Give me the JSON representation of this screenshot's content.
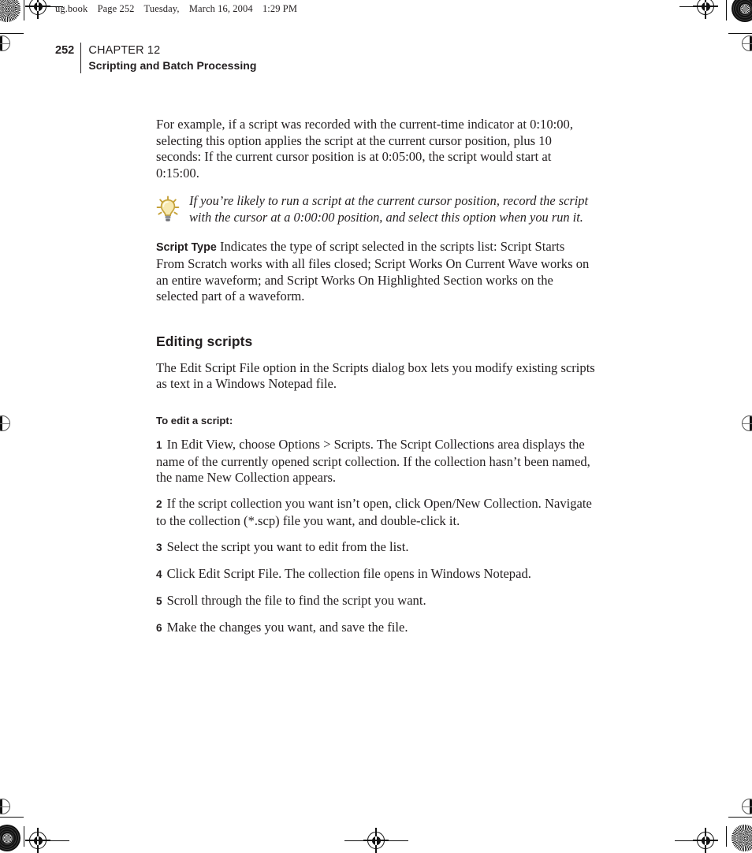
{
  "running_header": {
    "file": "ug.book",
    "page_label": "Page 252",
    "day": "Tuesday,",
    "date": "March 16, 2004",
    "time": "1:29 PM"
  },
  "chapter_head": {
    "folio": "252",
    "chapter_label": "CHAPTER 12",
    "chapter_title": "Scripting and Batch Processing"
  },
  "body": {
    "intro_paragraph": "For example, if a script was recorded with the current-time indicator at 0:10:00, selecting this option applies the script at the current cursor position, plus 10 seconds: If the current cursor position is at 0:05:00, the script would start at 0:15:00.",
    "tip": {
      "icon": "lightbulb-icon",
      "text": "If you’re likely to run a script at the current cursor position, record the script with the cursor at a 0:00:00 position, and select this option when you run it."
    },
    "script_type": {
      "term": "Script Type",
      "definition": "Indicates the type of script selected in the scripts list: Script Starts From Scratch works with all files closed; Script Works On Current Wave works on an entire waveform; and Script Works On Highlighted Section works on the selected part of a waveform."
    },
    "section": {
      "heading": "Editing scripts",
      "paragraph": "The Edit Script File option in the Scripts dialog box lets you modify existing scripts as text in a Windows Notepad file.",
      "procedure_heading": "To edit a script:",
      "steps": [
        {
          "num": "1",
          "text": "In Edit View, choose Options > Scripts. The Script Collections area displays the name of the currently opened script collection. If the collection hasn’t been named, the name New Collection appears."
        },
        {
          "num": "2",
          "text": "If the script collection you want isn’t open, click Open/New Collection. Navigate to the collection (*.scp) file you want, and double-click it."
        },
        {
          "num": "3",
          "text": "Select the script you want to edit from the list."
        },
        {
          "num": "4",
          "text": "Click Edit Script File. The collection file opens in Windows Notepad."
        },
        {
          "num": "5",
          "text": "Scroll through the file to find the script you want."
        },
        {
          "num": "6",
          "text": "Make the changes you want, and save the file."
        }
      ]
    }
  },
  "colors": {
    "text": "#231f20",
    "bulb_glass": "#f7e9b0",
    "bulb_outline": "#c5a23a",
    "bulb_base": "#8d9095",
    "mark_ink": "#111111"
  }
}
